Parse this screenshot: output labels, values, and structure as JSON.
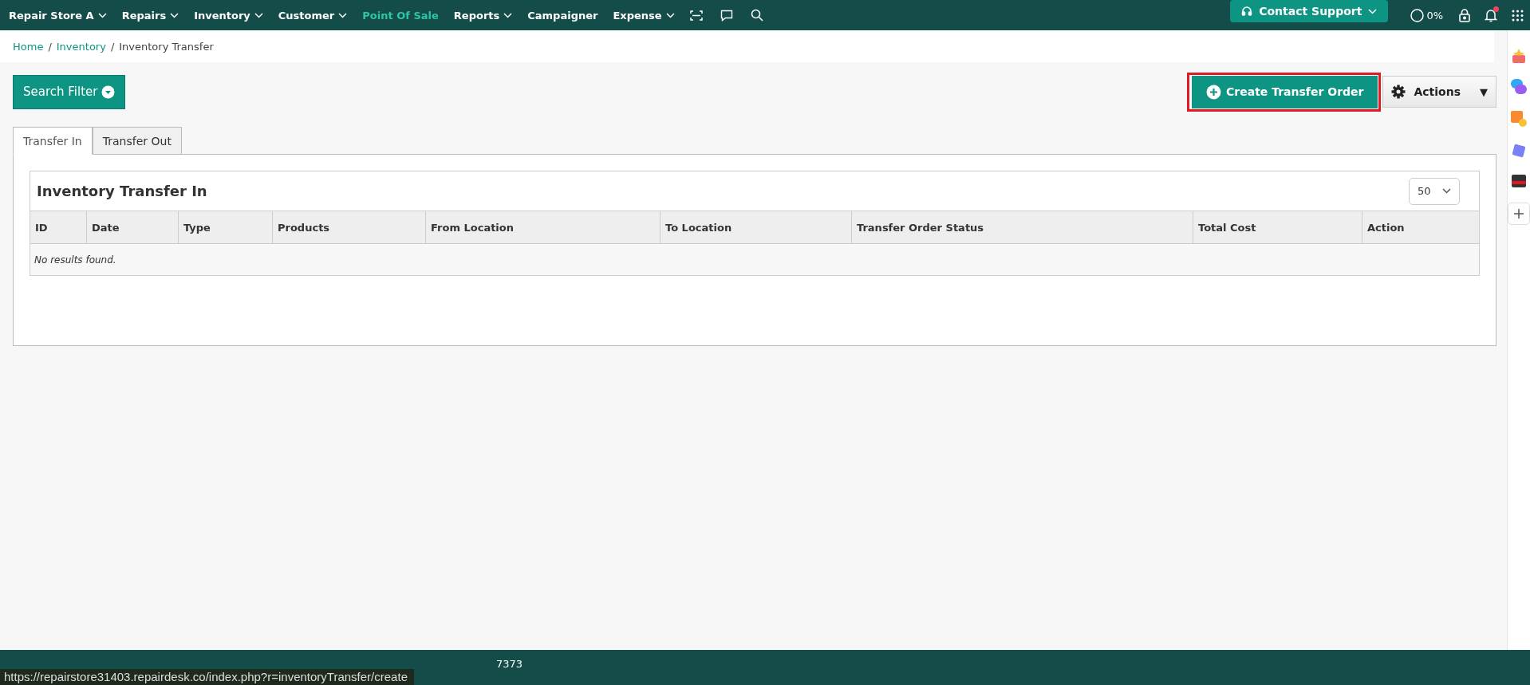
{
  "nav": {
    "items": [
      {
        "label": "Repair Store A",
        "dropdown": true,
        "selected": false
      },
      {
        "label": "Repairs",
        "dropdown": true,
        "selected": false
      },
      {
        "label": "Inventory",
        "dropdown": true,
        "selected": false
      },
      {
        "label": "Customer",
        "dropdown": true,
        "selected": false
      },
      {
        "label": "Point Of Sale",
        "dropdown": false,
        "selected": true
      },
      {
        "label": "Reports",
        "dropdown": true,
        "selected": false
      },
      {
        "label": "Campaigner",
        "dropdown": false,
        "selected": false
      },
      {
        "label": "Expense",
        "dropdown": true,
        "selected": false
      }
    ],
    "support": "Contact Support",
    "progress": "0%",
    "notification": true
  },
  "breadcrumb": [
    {
      "label": "Home",
      "kind": "link"
    },
    {
      "label": "/",
      "kind": "separator"
    },
    {
      "label": "Inventory",
      "kind": "link"
    },
    {
      "label": "/",
      "kind": "separator"
    },
    {
      "label": "Inventory Transfer",
      "kind": "current"
    }
  ],
  "search_filter": "Search Filter",
  "create_button": "Create Transfer Order",
  "actions_button": "Actions",
  "actions_caret": "▼",
  "tabs": [
    {
      "label": "Transfer In",
      "selected": true
    },
    {
      "label": "Transfer Out",
      "selected": false
    }
  ],
  "table": {
    "title": "Inventory Transfer In",
    "page_size": "50",
    "columns": [
      "ID",
      "Date",
      "Type",
      "Products",
      "From Location",
      "To Location",
      "Transfer Order Status",
      "Total Cost",
      "Action"
    ],
    "empty": "No results found."
  },
  "footer": "7373",
  "status_url": "https://repairstore31403.repairdesk.co/index.php?r=inventoryTransfer/create"
}
